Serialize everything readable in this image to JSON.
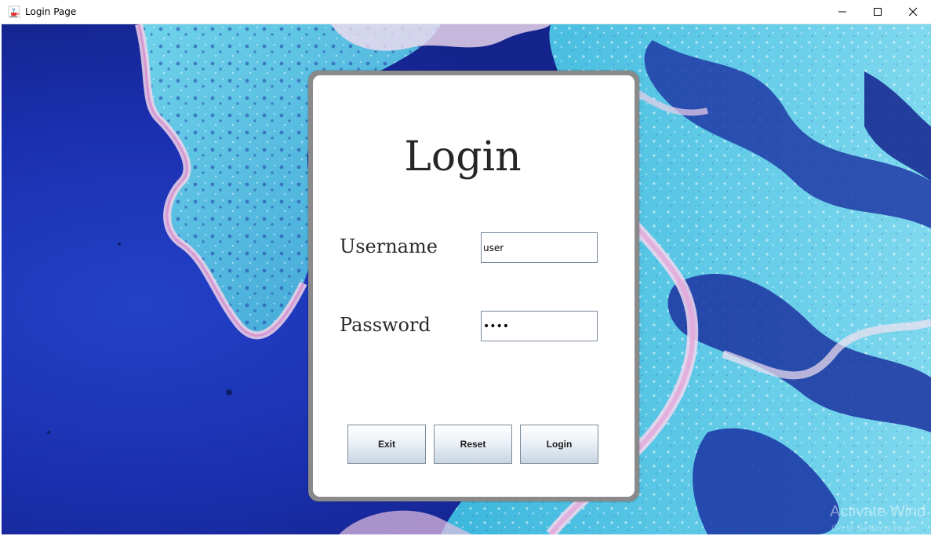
{
  "window": {
    "title": "Login Page",
    "icon": "java-cup-icon"
  },
  "form": {
    "heading": "Login",
    "username_label": "Username",
    "username_value": "user",
    "password_label": "Password",
    "password_value": "••••"
  },
  "buttons": {
    "exit_label": "Exit",
    "reset_label": "Reset",
    "login_label": "Login"
  },
  "watermark": {
    "line1": "Activate Wind",
    "line2": "Go to Settings to ac"
  },
  "colors": {
    "background_deep_blue": "#1a2fb0",
    "background_cyan": "#4fc3e0",
    "card_border": "#8a8a8a",
    "button_gradient_bottom": "#cad6e3"
  }
}
